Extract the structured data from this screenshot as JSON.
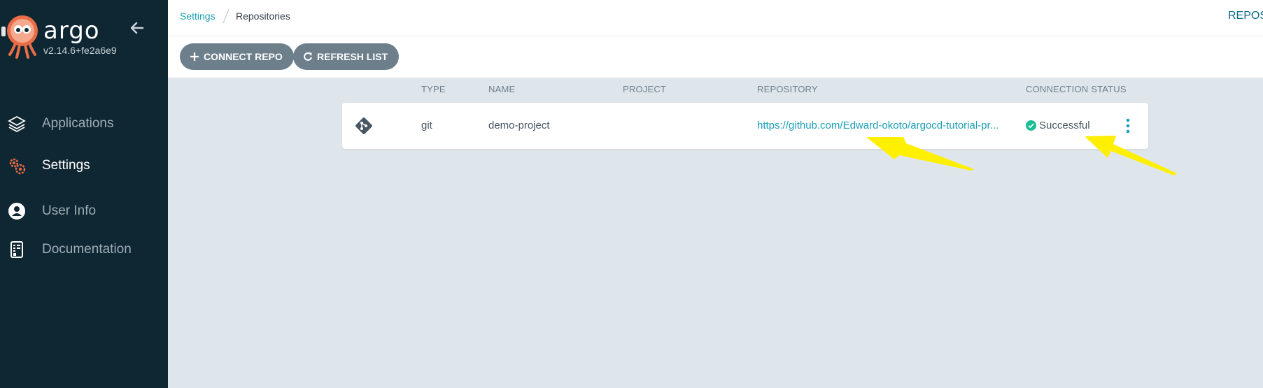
{
  "app": {
    "brand": "argo",
    "version": "v2.14.6+fe2a6e9"
  },
  "sidebar": {
    "items": [
      {
        "label": "Applications",
        "icon": "layers-icon",
        "active": false
      },
      {
        "label": "Settings",
        "icon": "gears-icon",
        "active": true
      },
      {
        "label": "User Info",
        "icon": "user-circle-icon",
        "active": false
      },
      {
        "label": "Documentation",
        "icon": "book-icon",
        "active": false
      }
    ]
  },
  "breadcrumb": {
    "parent": "Settings",
    "current": "Repositories"
  },
  "header": {
    "right_title": "REPOS"
  },
  "toolbar": {
    "connect_label": "CONNECT REPO",
    "refresh_label": "REFRESH LIST"
  },
  "table": {
    "columns": [
      "TYPE",
      "NAME",
      "PROJECT",
      "REPOSITORY",
      "CONNECTION STATUS"
    ],
    "rows": [
      {
        "type": "git",
        "name": "demo-project",
        "project": "",
        "repository": "https://github.com/Edward-okoto/argocd-tutorial-pr...",
        "status": "Successful"
      }
    ]
  },
  "colors": {
    "sidebar_bg": "#0f2733",
    "accent": "#1b9fb5",
    "success": "#18be94",
    "annotation": "#ffef00"
  }
}
